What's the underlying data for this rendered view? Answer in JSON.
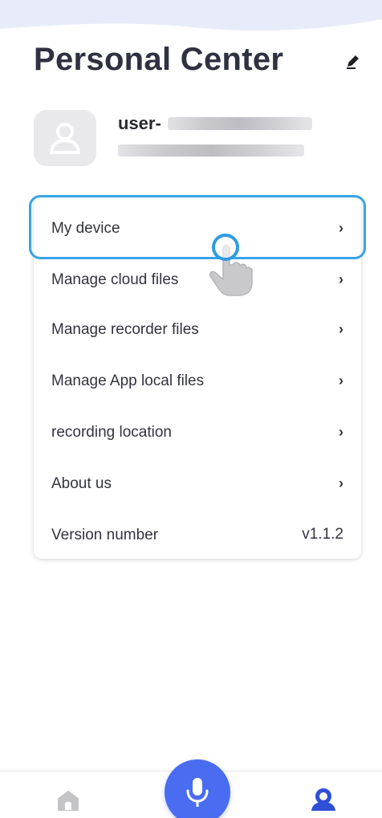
{
  "header": {
    "title": "Personal Center"
  },
  "profile": {
    "username_prefix": "user-"
  },
  "menu": {
    "items": [
      {
        "label": "My device",
        "chevron": "›"
      },
      {
        "label": "Manage cloud files",
        "chevron": "›"
      },
      {
        "label": "Manage recorder files",
        "chevron": "›"
      },
      {
        "label": "Manage App local files",
        "chevron": "›"
      },
      {
        "label": "recording location",
        "chevron": "›"
      },
      {
        "label": "About us",
        "chevron": "›"
      }
    ],
    "version": {
      "label": "Version number",
      "value": "v1.1.2"
    }
  },
  "tabbar": {
    "home_icon": "home-icon",
    "mic_icon": "microphone-icon",
    "profile_icon": "person-icon",
    "accent": "#4a6cf0",
    "active_color": "#2f4fd6",
    "inactive_color": "#c4c4c8"
  },
  "colors": {
    "highlight": "#3aa3e6",
    "title": "#2f3140"
  }
}
